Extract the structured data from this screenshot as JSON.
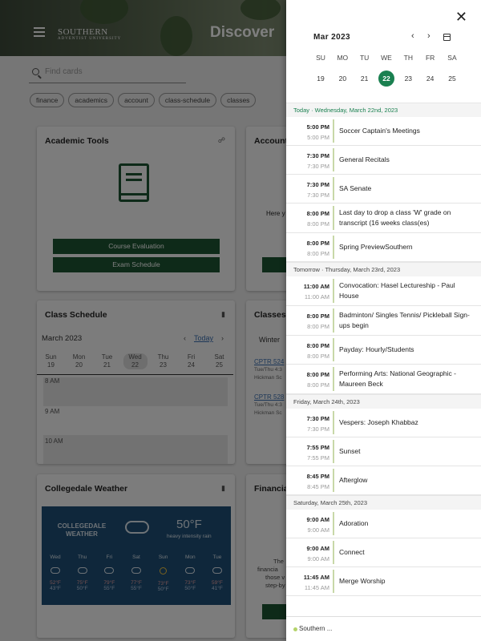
{
  "header": {
    "title": "Discover",
    "logo_text": "SOUTHERN",
    "logo_sub": "ADVENTIST UNIVERSITY"
  },
  "search": {
    "placeholder": "Find cards"
  },
  "chips": [
    "finance",
    "academics",
    "account",
    "class-schedule",
    "classes"
  ],
  "cards": {
    "academic_tools": {
      "title": "Academic Tools",
      "buttons": [
        "Course Evaluation",
        "Exam Schedule"
      ]
    },
    "account": {
      "title": "Account",
      "partial_text": "Here y"
    },
    "class_schedule": {
      "title": "Class Schedule",
      "month": "March 2023",
      "today_label": "Today",
      "days": [
        {
          "name": "Sun",
          "num": "19"
        },
        {
          "name": "Mon",
          "num": "20"
        },
        {
          "name": "Tue",
          "num": "21"
        },
        {
          "name": "Wed",
          "num": "22"
        },
        {
          "name": "Thu",
          "num": "23"
        },
        {
          "name": "Fri",
          "num": "24"
        },
        {
          "name": "Sat",
          "num": "25"
        }
      ],
      "slots": [
        "8 AM",
        "9 AM",
        "10 AM"
      ]
    },
    "classes": {
      "title": "Classes",
      "term": "Winter",
      "items": [
        {
          "code": "CPTR 524",
          "time": "Tue/Thu 4:3",
          "room": "Hickman Sc"
        },
        {
          "code": "CPTR 528",
          "time": "Tue/Thu 4:3",
          "room": "Hickman Sc"
        }
      ]
    },
    "weather": {
      "title": "Collegedale Weather",
      "city": "COLLEGEDALE WEATHER",
      "temp": "50°F",
      "desc": "heavy intensity rain",
      "days": [
        {
          "d": "Wed",
          "hi": "52°F",
          "lo": "43°F",
          "icon": "rain-icon"
        },
        {
          "d": "Thu",
          "hi": "75°F",
          "lo": "50°F",
          "icon": "cloud-icon"
        },
        {
          "d": "Fri",
          "hi": "79°F",
          "lo": "55°F",
          "icon": "cloud-icon"
        },
        {
          "d": "Sat",
          "hi": "77°F",
          "lo": "55°F",
          "icon": "rain-icon"
        },
        {
          "d": "Sun",
          "hi": "73°F",
          "lo": "50°F",
          "icon": "sun-icon"
        },
        {
          "d": "Mon",
          "hi": "73°F",
          "lo": "50°F",
          "icon": "rain-icon"
        },
        {
          "d": "Tue",
          "hi": "59°F",
          "lo": "41°F",
          "icon": "rain-icon"
        }
      ]
    },
    "financial": {
      "title": "Financia",
      "text_lines": [
        "The",
        "financia",
        "those v",
        "step-by"
      ]
    }
  },
  "drawer": {
    "month": "Mar 2023",
    "weekday_heads": [
      "SU",
      "MO",
      "TU",
      "WE",
      "TH",
      "FR",
      "SA"
    ],
    "week_days": [
      "19",
      "20",
      "21",
      "22",
      "23",
      "24",
      "25"
    ],
    "selected_day": "22",
    "sections": [
      {
        "header": "Today · Wednesday, March 22nd, 2023",
        "today": true,
        "events": [
          {
            "start": "5:00 PM",
            "end": "5:00 PM",
            "title": "Soccer Captain's Meetings"
          },
          {
            "start": "7:30 PM",
            "end": "7:30 PM",
            "title": "General Recitals"
          },
          {
            "start": "7:30 PM",
            "end": "7:30 PM",
            "title": "SA Senate"
          },
          {
            "start": "8:00 PM",
            "end": "8:00 PM",
            "title": "Last day to drop a class 'W' grade on transcript (16 weeks class(es)"
          },
          {
            "start": "8:00 PM",
            "end": "8:00 PM",
            "title": "Spring PreviewSouthern"
          }
        ]
      },
      {
        "header": "Tomorrow · Thursday, March 23rd, 2023",
        "today": false,
        "events": [
          {
            "start": "11:00 AM",
            "end": "11:00 AM",
            "title": "Convocation: Hasel Lectureship - Paul House"
          },
          {
            "start": "8:00 PM",
            "end": "8:00 PM",
            "title": "Badminton/ Singles Tennis/ Pickleball Sign-ups begin"
          },
          {
            "start": "8:00 PM",
            "end": "8:00 PM",
            "title": "Payday: Hourly/Students"
          },
          {
            "start": "8:00 PM",
            "end": "8:00 PM",
            "title": "Performing Arts: National Geographic - Maureen Beck"
          }
        ]
      },
      {
        "header": "Friday, March 24th, 2023",
        "today": false,
        "events": [
          {
            "start": "7:30 PM",
            "end": "7:30 PM",
            "title": "Vespers: Joseph Khabbaz"
          },
          {
            "start": "7:55 PM",
            "end": "7:55 PM",
            "title": "Sunset"
          },
          {
            "start": "8:45 PM",
            "end": "8:45 PM",
            "title": "Afterglow"
          }
        ]
      },
      {
        "header": "Saturday, March 25th, 2023",
        "today": false,
        "events": [
          {
            "start": "9:00 AM",
            "end": "9:00 AM",
            "title": "Adoration"
          },
          {
            "start": "9:00 AM",
            "end": "9:00 AM",
            "title": "Connect"
          },
          {
            "start": "11:45 AM",
            "end": "11:45 AM",
            "title": "Merge Worship"
          }
        ]
      }
    ],
    "footer_label": "Southern ..."
  }
}
